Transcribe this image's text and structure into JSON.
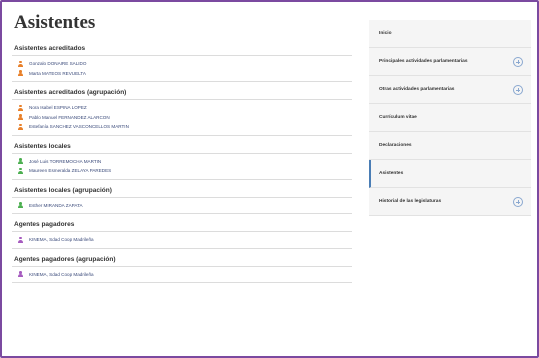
{
  "page": {
    "title": "Asistentes"
  },
  "sections": [
    {
      "heading": "Asistentes acreditados",
      "icon_color": "#e8802a",
      "items": [
        "Gonzalo DONAIRE SALIDO",
        "Marta MATEOS REVUELTA"
      ]
    },
    {
      "heading": "Asistentes acreditados (agrupación)",
      "icon_color": "#e8802a",
      "items": [
        "Nora Isabel ESPINA LOPEZ",
        "Pablo Manuel FERNANDEZ ALARCON",
        "Estefanía SANCHEZ VASCONCELLOS MARTIN"
      ]
    },
    {
      "heading": "Asistentes locales",
      "icon_color": "#4caf50",
      "items": [
        "José Luis TORREMOCHA MARTIN",
        "Maureen Esmeralda ZELAYA PAREDES"
      ]
    },
    {
      "heading": "Asistentes locales (agrupación)",
      "icon_color": "#4caf50",
      "items": [
        "Esther MIRANDA ZAPATA"
      ]
    },
    {
      "heading": "Agentes pagadores",
      "icon_color": "#a65bbf",
      "items": [
        "KINEMA, Sdad Coop Madrileña"
      ]
    },
    {
      "heading": "Agentes pagadores (agrupación)",
      "icon_color": "#a65bbf",
      "items": [
        "KINEMA, Sdad Coop Madrileña"
      ]
    }
  ],
  "sidebar": {
    "items": [
      {
        "label": "Inicio",
        "expandable": false,
        "active": false
      },
      {
        "label": "Principales actividades parlamentarias",
        "expandable": true,
        "active": false
      },
      {
        "label": "Otras actividades parlamentarias",
        "expandable": true,
        "active": false
      },
      {
        "label": "Currículum vitae",
        "expandable": false,
        "active": false
      },
      {
        "label": "Declaraciones",
        "expandable": false,
        "active": false
      },
      {
        "label": "Asistentes",
        "expandable": false,
        "active": true
      },
      {
        "label": "Historial de las legislaturas",
        "expandable": true,
        "active": false
      }
    ]
  }
}
